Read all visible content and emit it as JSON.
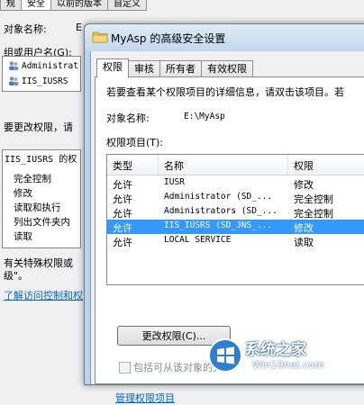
{
  "back_dialog": {
    "tabs": [
      "规",
      "安全",
      "以前的版本",
      "自定义"
    ],
    "object_label": "对象名称:",
    "object_value": "E",
    "group_label": "组或用户名(G):",
    "users": [
      "Administrat",
      "IIS_IUSRS"
    ],
    "change_hint": "要更改权限，请",
    "perm_header": "IIS_IUSRS 的权",
    "perms": [
      "完全控制",
      "修改",
      "读取和执行",
      "列出文件夹内",
      "读取"
    ],
    "special_text_1": "有关特殊权限或",
    "special_text_2": "级\"。",
    "link_text": "了解访问控制和权"
  },
  "front_dialog": {
    "title": "MyAsp 的高级安全设置",
    "tabs": [
      "权限",
      "审核",
      "所有者",
      "有效权限"
    ],
    "active_tab": "权限",
    "instructions": "若要查看某个权限项目的详细信息，请双击该项目。若",
    "object_label": "对象名称:",
    "object_value": "E:\\MyAsp",
    "entries_label": "权限项目(T):",
    "columns": [
      "类型",
      "名称",
      "权限"
    ],
    "rows": [
      {
        "type": "允许",
        "name": "IUSR",
        "perm": "修改"
      },
      {
        "type": "允许",
        "name": "Administrator (SD_...",
        "perm": "完全控制"
      },
      {
        "type": "允许",
        "name": "Administrators (SD_...",
        "perm": "完全控制"
      },
      {
        "type": "允许",
        "name": "IIS_IUSRS (SD_JNS_...",
        "perm": "修改"
      },
      {
        "type": "允许",
        "name": "LOCAL SERVICE",
        "perm": "读取"
      }
    ],
    "selected_row": 3,
    "change_button": "更改权限(C)...",
    "inherit_checkbox": "包括可从该对象的父",
    "manage_link": "管理权限项目"
  },
  "watermark": {
    "text1": "系统之家",
    "text2": "Win10net.com"
  },
  "colors": {
    "selection": "#3399ff",
    "link": "#0066cc",
    "title_bar": "#c3d7ec"
  }
}
